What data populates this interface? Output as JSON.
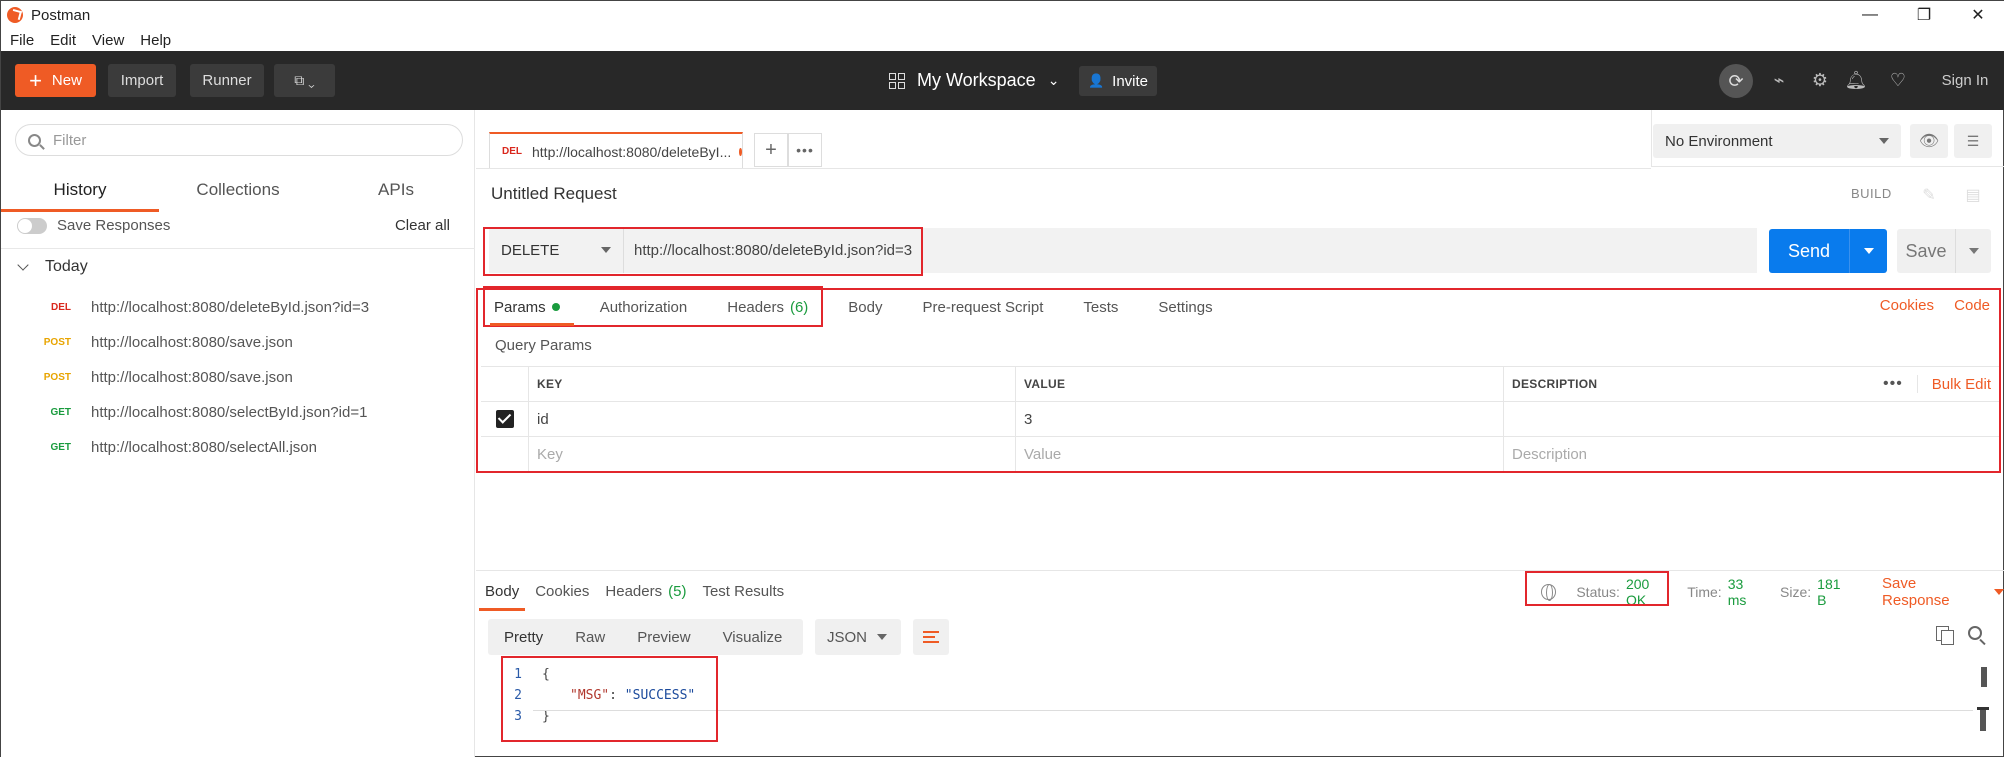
{
  "window": {
    "title": "Postman",
    "controls": [
      "—",
      "❐",
      "✕"
    ]
  },
  "menu": [
    "File",
    "Edit",
    "View",
    "Help"
  ],
  "toolbar": {
    "new_label": "New",
    "import_label": "Import",
    "runner_label": "Runner",
    "workspace_label": "My Workspace",
    "invite_label": "Invite",
    "signin_label": "Sign In"
  },
  "sidebar": {
    "filter_placeholder": "Filter",
    "tabs": [
      "History",
      "Collections",
      "APIs"
    ],
    "save_responses_label": "Save Responses",
    "clear_all_label": "Clear all",
    "group_label": "Today",
    "history": [
      {
        "method": "DEL",
        "url": "http://localhost:8080/deleteById.json?id=3"
      },
      {
        "method": "POST",
        "url": "http://localhost:8080/save.json"
      },
      {
        "method": "POST",
        "url": "http://localhost:8080/save.json"
      },
      {
        "method": "GET",
        "url": "http://localhost:8080/selectById.json?id=1"
      },
      {
        "method": "GET",
        "url": "http://localhost:8080/selectAll.json"
      }
    ]
  },
  "request_tab": {
    "method": "DEL",
    "title": "http://localhost:8080/deleteByI..."
  },
  "environment": {
    "selected": "No Environment"
  },
  "request": {
    "title": "Untitled Request",
    "build_label": "BUILD",
    "method": "DELETE",
    "url": "http://localhost:8080/deleteById.json?id=3",
    "send_label": "Send",
    "save_label": "Save"
  },
  "request_tabs": {
    "params": "Params",
    "authorization": "Authorization",
    "headers": "Headers",
    "headers_count": "(6)",
    "body": "Body",
    "prerequest": "Pre-request Script",
    "tests": "Tests",
    "settings": "Settings",
    "cookies": "Cookies",
    "code": "Code"
  },
  "query_params": {
    "label": "Query Params",
    "columns": [
      "KEY",
      "VALUE",
      "DESCRIPTION"
    ],
    "bulk_edit": "Bulk Edit",
    "rows": [
      {
        "key": "id",
        "value": "3",
        "description": ""
      }
    ],
    "placeholder": {
      "key": "Key",
      "value": "Value",
      "description": "Description"
    }
  },
  "response": {
    "tabs": {
      "body": "Body",
      "cookies": "Cookies",
      "headers": "Headers",
      "headers_count": "(5)",
      "test_results": "Test Results"
    },
    "status_label": "Status:",
    "status_value": "200 OK",
    "time_label": "Time:",
    "time_value": "33 ms",
    "size_label": "Size:",
    "size_value": "181 B",
    "save_response_label": "Save Response",
    "views": [
      "Pretty",
      "Raw",
      "Preview",
      "Visualize"
    ],
    "format": "JSON",
    "code_lines": [
      {
        "num": "1",
        "text": "{"
      },
      {
        "num": "2",
        "key": "\"MSG\"",
        "sep": ": ",
        "value": "\"SUCCESS\""
      },
      {
        "num": "3",
        "text": "}"
      }
    ]
  },
  "colors": {
    "accent": "#ef5b25",
    "send": "#097bed",
    "highlight": "#e2262c",
    "success": "#1a9b3e"
  }
}
